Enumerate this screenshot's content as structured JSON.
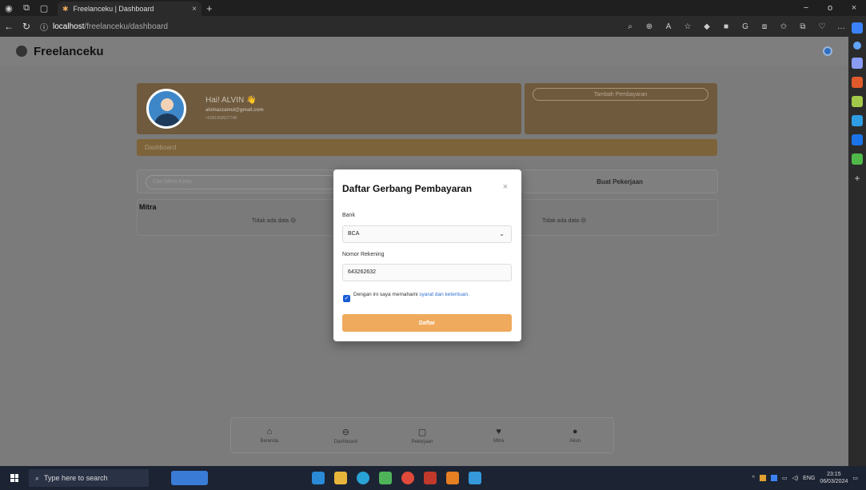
{
  "browser": {
    "tab_title": "Freelanceku | Dashboard",
    "tab_close": "×",
    "new_tab": "+",
    "url_host": "localhost",
    "url_path": "/freelanceku/dashboard",
    "win_min": "−",
    "win_max": "o",
    "win_close": "×"
  },
  "app": {
    "name": "Freelanceku"
  },
  "profile": {
    "greeting": "Hai! ALVIN 👋",
    "email": "alvinazzamul@gmail.com",
    "phone": "+6281968637748"
  },
  "payment": {
    "add_button": "Tambah Pembayaran"
  },
  "dashboard": {
    "bar_label": "Dashboard",
    "search_placeholder": "Cari Mitra Kerja",
    "create_job": "Buat Pekerjaan",
    "mitra_title": "Mitra",
    "no_data_left": "Tidak ada data 😢",
    "no_data_right": "Tidak ada data 😢"
  },
  "bottom_nav": [
    {
      "label": "Beranda",
      "icon": "home-icon",
      "glyph": "⌂"
    },
    {
      "label": "Dashboard",
      "icon": "dashboard-icon",
      "glyph": "⊖"
    },
    {
      "label": "Pekerjaan",
      "icon": "job-icon",
      "glyph": "▢"
    },
    {
      "label": "Mitra",
      "icon": "mitra-icon",
      "glyph": "♥"
    },
    {
      "label": "Akun",
      "icon": "account-icon",
      "glyph": "●"
    }
  ],
  "modal": {
    "title": "Daftar Gerbang Pembayaran",
    "close": "×",
    "bank_label": "Bank",
    "bank_value": "BCA",
    "rekening_label": "Nomor Rekening",
    "rekening_value": "643262632",
    "checkbox_text": "Dengan ini saya memahami ",
    "checkbox_link": "syarat dan ketentuan.",
    "checkbox_checked": true,
    "submit": "Daftar"
  },
  "taskbar": {
    "search_placeholder": "Type here to search",
    "lang": "ENG",
    "time": "23:15",
    "date": "06/03/2024"
  },
  "colors": {
    "accent": "#f0aa5d",
    "link": "#2e6fd0",
    "checkbox": "#1a5bd6"
  }
}
